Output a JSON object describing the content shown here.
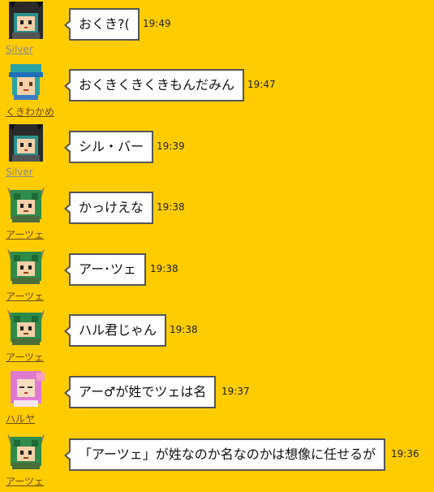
{
  "messages": [
    {
      "user": "Silver",
      "avatar": "black-cat-hood-avatar",
      "text": "おくき?(",
      "time": "19:49"
    },
    {
      "user": "くきわかめ",
      "avatar": "teal-hat-avatar",
      "text": "おくきくきくきもんだみん",
      "time": "19:47"
    },
    {
      "user": "Silver",
      "avatar": "black-cat-hood-avatar",
      "text": "シル・バー",
      "time": "19:39"
    },
    {
      "user": "アーツェ",
      "avatar": "green-dragon-avatar",
      "text": "かっけえな",
      "time": "19:38"
    },
    {
      "user": "アーツェ",
      "avatar": "green-dragon-avatar",
      "text": "アー･ツェ",
      "time": "19:38"
    },
    {
      "user": "アーツェ",
      "avatar": "green-dragon-avatar",
      "text": "ハル君じゃん",
      "time": "19:38"
    },
    {
      "user": "ハルヤ",
      "avatar": "pink-hair-avatar",
      "text": "アー♂が姓でツェは名",
      "time": "19:37"
    },
    {
      "user": "アーツェ",
      "avatar": "green-dragon-avatar",
      "text": "「アーツェ」が姓なのか名なのかは想像に任せるが",
      "time": "19:36"
    }
  ],
  "colors": {
    "background": "#ffcc00",
    "bubble_border": "#555555",
    "bubble_bg": "#ffffff"
  }
}
